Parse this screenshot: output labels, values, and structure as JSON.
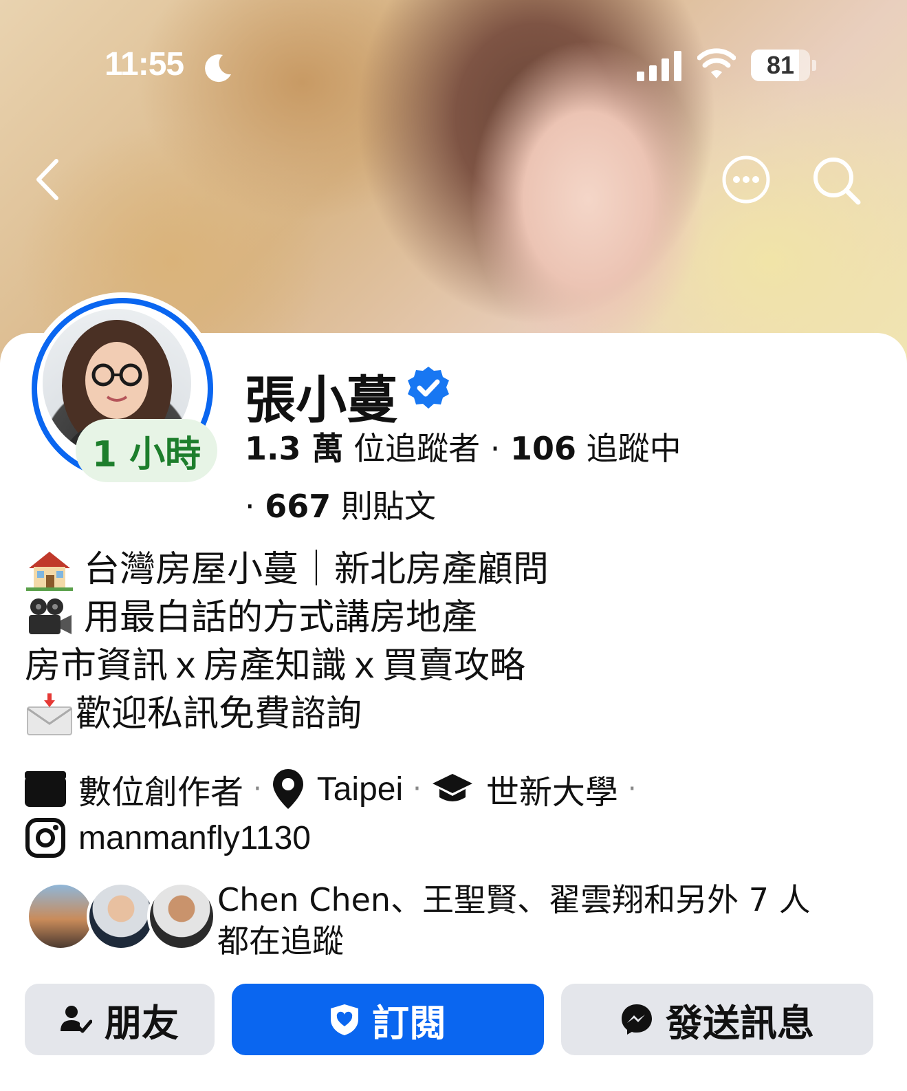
{
  "status_bar": {
    "time": "11:55",
    "battery": "81",
    "battery_level": 0.81
  },
  "profile": {
    "name": "張小蔓",
    "story_badge": "1 小時",
    "followers_count": "1.3 萬",
    "followers_label": "位追蹤者",
    "following_count": "106",
    "following_label": "追蹤中",
    "posts_count": "667",
    "posts_label": "則貼文"
  },
  "bio": {
    "line1": "台灣房屋小蔓｜新北房產顧問",
    "line2": "用最白話的方式講房地產",
    "line3": "房市資訊ｘ房產知識ｘ買賣攻略",
    "line4": "歡迎私訊免費諮詢"
  },
  "details": {
    "category": "數位創作者",
    "location": "Taipei",
    "school": "世新大學",
    "instagram": "manmanfly1130"
  },
  "mutual": {
    "text_line1": "Chen Chen、王聖賢、翟雲翔和另外 7 人",
    "text_line2": "都在追蹤"
  },
  "buttons": {
    "friends": "朋友",
    "subscribe": "訂閱",
    "message": "發送訊息"
  },
  "colors": {
    "accent": "#0a66f0",
    "badge_green": "#1d7e2c",
    "button_gray": "#e4e6eb"
  }
}
